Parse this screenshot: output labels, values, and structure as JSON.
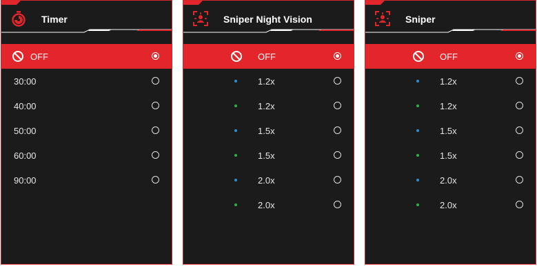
{
  "colors": {
    "accent": "#e3262b",
    "panel_bg": "#1b1b1b",
    "dot_blue": "#2f8fd6",
    "dot_green": "#2db34a"
  },
  "panels": [
    {
      "title": "Timer",
      "icon": "stopwatch-icon",
      "options": [
        {
          "label": "OFF",
          "selected": true
        },
        {
          "label": "30:00"
        },
        {
          "label": "40:00"
        },
        {
          "label": "50:00"
        },
        {
          "label": "60:00"
        },
        {
          "label": "90:00"
        }
      ]
    },
    {
      "title": "Sniper Night Vision",
      "icon": "sniper-crosshair-icon",
      "options": [
        {
          "label": "OFF",
          "selected": true
        },
        {
          "label": "1.2x",
          "dot": "blue"
        },
        {
          "label": "1.2x",
          "dot": "green"
        },
        {
          "label": "1.5x",
          "dot": "blue"
        },
        {
          "label": "1.5x",
          "dot": "green"
        },
        {
          "label": "2.0x",
          "dot": "blue"
        },
        {
          "label": "2.0x",
          "dot": "green"
        }
      ]
    },
    {
      "title": "Sniper",
      "icon": "sniper-crosshair-icon",
      "options": [
        {
          "label": "OFF",
          "selected": true
        },
        {
          "label": "1.2x",
          "dot": "blue"
        },
        {
          "label": "1.2x",
          "dot": "green"
        },
        {
          "label": "1.5x",
          "dot": "blue"
        },
        {
          "label": "1.5x",
          "dot": "green"
        },
        {
          "label": "2.0x",
          "dot": "blue"
        },
        {
          "label": "2.0x",
          "dot": "green"
        }
      ]
    }
  ]
}
